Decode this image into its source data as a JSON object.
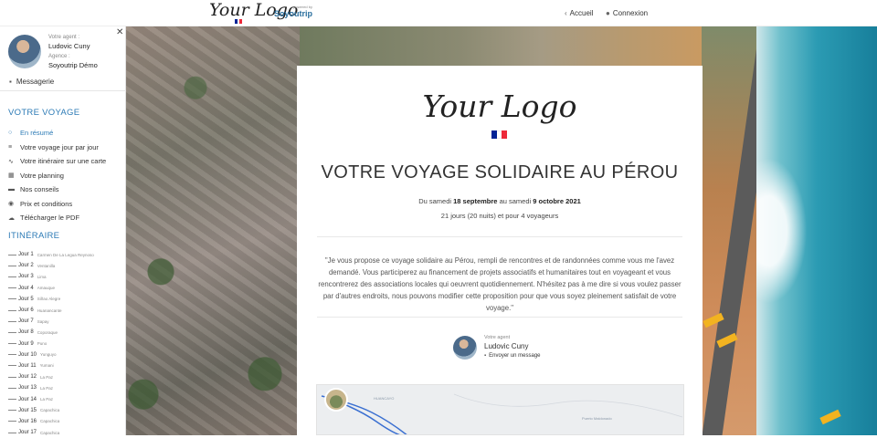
{
  "header": {
    "logo_text": "Your Logo",
    "powered_small": "powered by",
    "powered_brand": "Soyoutrip",
    "nav_home": "Accueil",
    "nav_login": "Connexion"
  },
  "sidebar": {
    "agent_label": "Votre agent :",
    "agent_name": "Ludovic Cuny",
    "agency_label": "Agence :",
    "agency_name": "Soyoutrip Démo",
    "messaging": "Messagerie",
    "section_trip": "VOTRE VOYAGE",
    "menu": [
      {
        "label": "En résumé",
        "icon": "circle-icon"
      },
      {
        "label": "Votre voyage jour par jour",
        "icon": "list-icon"
      },
      {
        "label": "Votre itinéraire sur une carte",
        "icon": "route-icon"
      },
      {
        "label": "Votre planning",
        "icon": "calendar-icon"
      },
      {
        "label": "Nos conseils",
        "icon": "book-icon"
      },
      {
        "label": "Prix et conditions",
        "icon": "price-icon"
      },
      {
        "label": "Télécharger le PDF",
        "icon": "download-icon"
      }
    ],
    "section_itinerary": "ITINÉRAIRE",
    "days": [
      {
        "day": "Jour 1",
        "place": "Carmen De La Legua Reynoso"
      },
      {
        "day": "Jour 2",
        "place": "Ventanilla"
      },
      {
        "day": "Jour 3",
        "place": "Lima"
      },
      {
        "day": "Jour 4",
        "place": "Amauque"
      },
      {
        "day": "Jour 5",
        "place": "Siñao Alegre"
      },
      {
        "day": "Jour 6",
        "place": "Huanancante"
      },
      {
        "day": "Jour 7",
        "place": "Sapay"
      },
      {
        "day": "Jour 8",
        "place": "Coporaque"
      },
      {
        "day": "Jour 9",
        "place": "Puno"
      },
      {
        "day": "Jour 10",
        "place": "Yunguyo"
      },
      {
        "day": "Jour 11",
        "place": "Yumani"
      },
      {
        "day": "Jour 12",
        "place": "La Paz"
      },
      {
        "day": "Jour 13",
        "place": "La Paz"
      },
      {
        "day": "Jour 14",
        "place": "La Paz"
      },
      {
        "day": "Jour 15",
        "place": "Capachica"
      },
      {
        "day": "Jour 16",
        "place": "Capachica"
      },
      {
        "day": "Jour 17",
        "place": "Capachica"
      }
    ]
  },
  "card": {
    "logo_text": "Your Logo",
    "title": "VOTRE VOYAGE SOLIDAIRE AU PÉROU",
    "dates_prefix": "Du samedi ",
    "date_start": "18 septembre",
    "dates_mid": " au samedi ",
    "date_end": "9 octobre 2021",
    "duration": "21 jours (20 nuits) et pour 4 voyageurs",
    "quote": "\"Je vous propose ce voyage solidaire au Pérou, rempli de rencontres et de randonnées comme vous me l'avez demandé. Vous participerez au financement de projets associatifs et humanitaires tout en voyageant et vous rencontrerez des associations locales qui oeuvrent quotidiennement. N'hésitez pas à me dire si vous voulez passer par d'autres endroits, nous pouvons modifier cette proposition pour que vous soyez pleinement satisfait de votre voyage.\"",
    "agent_label": "Votre agent",
    "agent_name": "Ludovic Cuny",
    "send_message": "Envoyer un message",
    "map_labels": [
      "HUANCAYO",
      "Puerto Maldonado"
    ]
  },
  "colors": {
    "accent": "#2d7bb6",
    "flag_blue": "#002395",
    "flag_white": "#ffffff",
    "flag_red": "#ed2939"
  }
}
